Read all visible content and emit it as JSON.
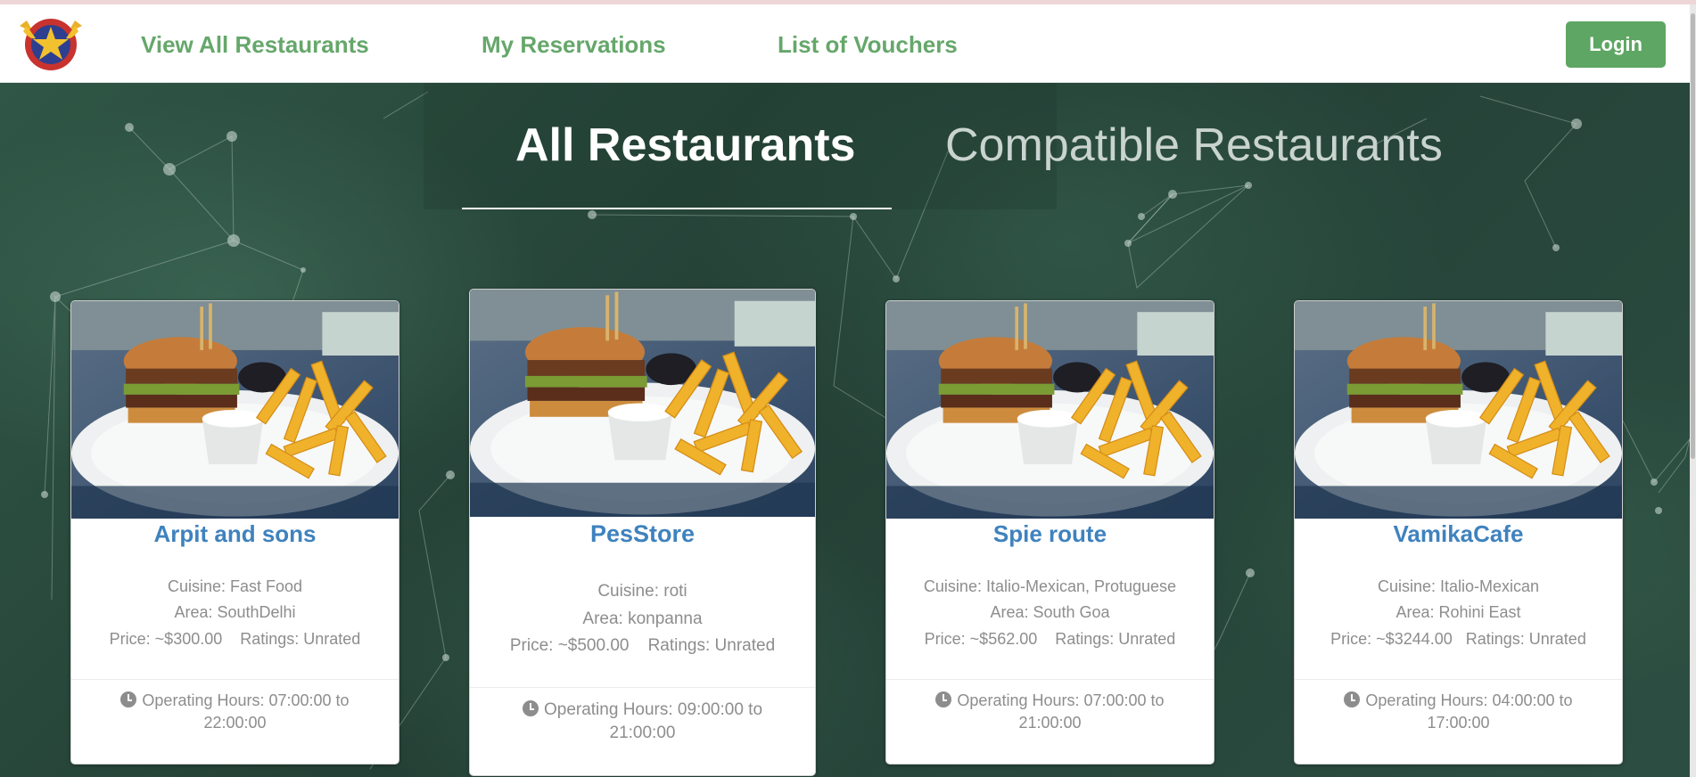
{
  "nav": {
    "logo_icon": "captain-shield-star-logo",
    "links": [
      "View All Restaurants",
      "My Reservations",
      "List of Vouchers"
    ],
    "login_label": "Login"
  },
  "tabs": {
    "active": "All Restaurants",
    "inactive": "Compatible Restaurants"
  },
  "restaurants": [
    {
      "name": "Arpit and sons",
      "cuisine": "Cuisine: Fast Food",
      "area": "Area: SouthDelhi",
      "price_rating": "Price: ~$300.00    Ratings: Unrated",
      "hours_icon": "clock-icon",
      "hours_line1": "Operating Hours: 07:00:00 to",
      "hours_line2": "22:00:00"
    },
    {
      "name": "PesStore",
      "cuisine": "Cuisine: roti",
      "area": "Area: konpanna",
      "price_rating": "Price: ~$500.00    Ratings: Unrated",
      "hours_icon": "clock-icon",
      "hours_line1": "Operating Hours: 09:00:00 to",
      "hours_line2": "21:00:00"
    },
    {
      "name": "Spie route",
      "cuisine": "Cuisine: Italio-Mexican, Protuguese",
      "area": "Area: South Goa",
      "price_rating": "Price: ~$562.00    Ratings: Unrated",
      "hours_icon": "clock-icon",
      "hours_line1": "Operating Hours: 07:00:00 to",
      "hours_line2": "21:00:00"
    },
    {
      "name": "VamikaCafe",
      "cuisine": "Cuisine: Italio-Mexican",
      "area": "Area: Rohini East",
      "price_rating": "Price: ~$3244.00   Ratings: Unrated",
      "hours_icon": "clock-icon",
      "hours_line1": "Operating Hours: 04:00:00 to",
      "hours_line2": "17:00:00"
    }
  ],
  "colors": {
    "nav_link": "#66a76b",
    "login_button": "#5da663",
    "restaurant_name": "#3f82be",
    "background": "#2a4a3f"
  }
}
